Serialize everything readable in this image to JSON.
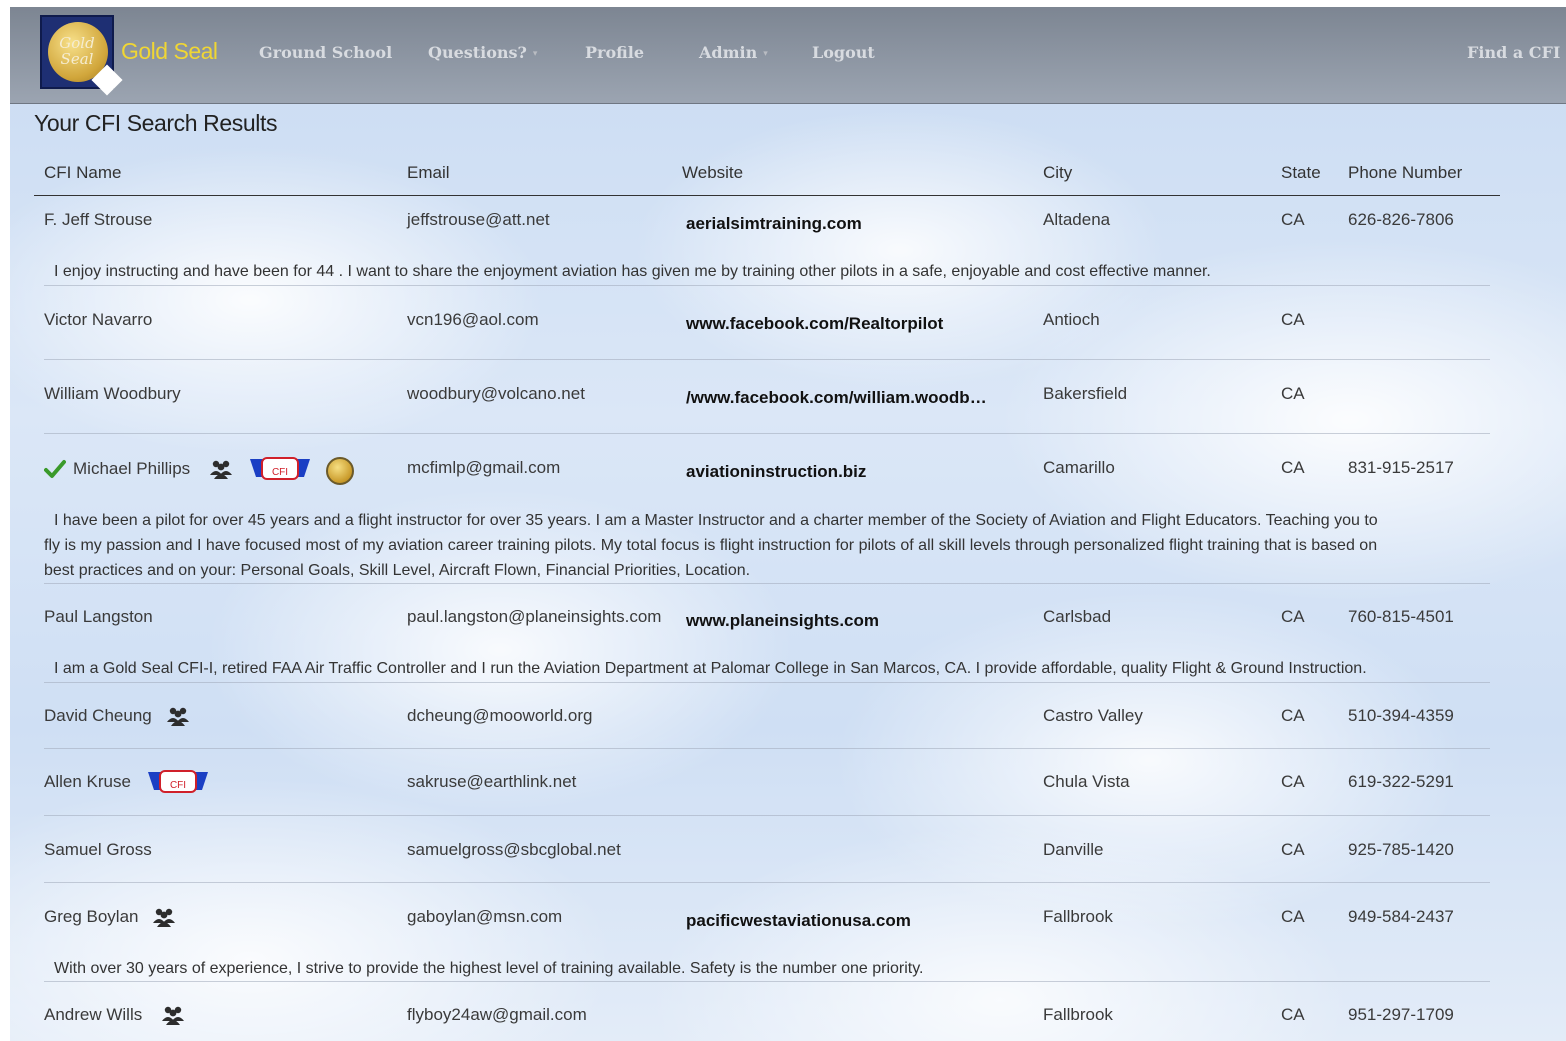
{
  "nav": {
    "logo_text_line1": "Gold",
    "logo_text_line2": "Seal",
    "brand": "Gold Seal",
    "items": [
      {
        "label": "Ground School",
        "dropdown": false
      },
      {
        "label": "Questions?",
        "dropdown": true
      },
      {
        "label": "Profile",
        "dropdown": false
      },
      {
        "label": "Admin",
        "dropdown": true
      },
      {
        "label": "Logout",
        "dropdown": false
      }
    ],
    "right_link": "Find a CFI"
  },
  "page_title": "Your CFI Search Results",
  "columns": {
    "name": "CFI Name",
    "email": "Email",
    "website": "Website",
    "city": "City",
    "state": "State",
    "phone": "Phone Number"
  },
  "rows": [
    {
      "name": "F. Jeff Strouse",
      "email": "jeffstrouse@att.net",
      "website": "aerialsimtraining.com",
      "city": "Altadena",
      "state": "CA",
      "phone": "626-826-7806",
      "description": "I enjoy instructing and have been for 44 . I want to share the enjoyment aviation has given me by training other pilots in a safe, enjoyable and cost effective manner."
    },
    {
      "name": "Victor Navarro",
      "email": "vcn196@aol.com",
      "website": "www.facebook.com/Realtorpilot",
      "city": "Antioch",
      "state": "CA",
      "phone": ""
    },
    {
      "name": "William Woodbury",
      "email": "woodbury@volcano.net",
      "website": "/www.facebook.com/william.woodb…",
      "city": "Bakersfield",
      "state": "CA",
      "phone": ""
    },
    {
      "name": "Michael Phillips",
      "email": "mcfimlp@gmail.com",
      "website": "aviationinstruction.biz",
      "city": "Camarillo",
      "state": "CA",
      "phone": "831-915-2517",
      "badges": [
        "verified-check",
        "group-instructor",
        "master-cfi",
        "gold-seal"
      ],
      "master_text": "CFI",
      "description_lines": [
        "I have been a pilot for over 45 years and a flight instructor for over 35 years. I am a Master Instructor and a charter member of the Society of Aviation and Flight Educators. Teaching you to",
        "fly is my passion and I have focused most of my aviation career training pilots. My total focus is flight instruction for pilots of all skill levels through personalized flight training that is based on",
        "best practices and on your: Personal Goals, Skill Level, Aircraft Flown, Financial Priorities, Location."
      ]
    },
    {
      "name": "Paul Langston",
      "email": "paul.langston@planeinsights.com",
      "website": "www.planeinsights.com",
      "city": "Carlsbad",
      "state": "CA",
      "phone": "760-815-4501",
      "description": "I am a Gold Seal CFI-I, retired FAA Air Traffic Controller and I run the Aviation Department at Palomar College in San Marcos, CA. I provide affordable, quality Flight & Ground Instruction."
    },
    {
      "name": "David Cheung",
      "email": "dcheung@mooworld.org",
      "website": "",
      "city": "Castro Valley",
      "state": "CA",
      "phone": "510-394-4359",
      "badges": [
        "group-instructor"
      ]
    },
    {
      "name": "Allen Kruse",
      "email": "sakruse@earthlink.net",
      "website": "",
      "city": "Chula Vista",
      "state": "CA",
      "phone": "619-322-5291",
      "badges": [
        "master-cfi"
      ],
      "master_text": "CFI"
    },
    {
      "name": "Samuel Gross",
      "email": "samuelgross@sbcglobal.net",
      "website": "",
      "city": "Danville",
      "state": "CA",
      "phone": "925-785-1420"
    },
    {
      "name": "Greg Boylan",
      "email": "gaboylan@msn.com",
      "website": "pacificwestaviationusa.com",
      "city": "Fallbrook",
      "state": "CA",
      "phone": "949-584-2437",
      "badges": [
        "group-instructor"
      ],
      "description": "With over 30 years of experience, I strive to provide the highest level of training available. Safety is the number one priority."
    },
    {
      "name": "Andrew Wills",
      "email": "flyboy24aw@gmail.com",
      "website": "",
      "city": "Fallbrook",
      "state": "CA",
      "phone": "951-297-1709",
      "badges": [
        "group-instructor"
      ]
    }
  ],
  "colors": {
    "brand": "#f0d634",
    "navbar": "#7c848f",
    "master_badge_blue": "#1b3fc4",
    "master_badge_red": "#d0202a"
  }
}
